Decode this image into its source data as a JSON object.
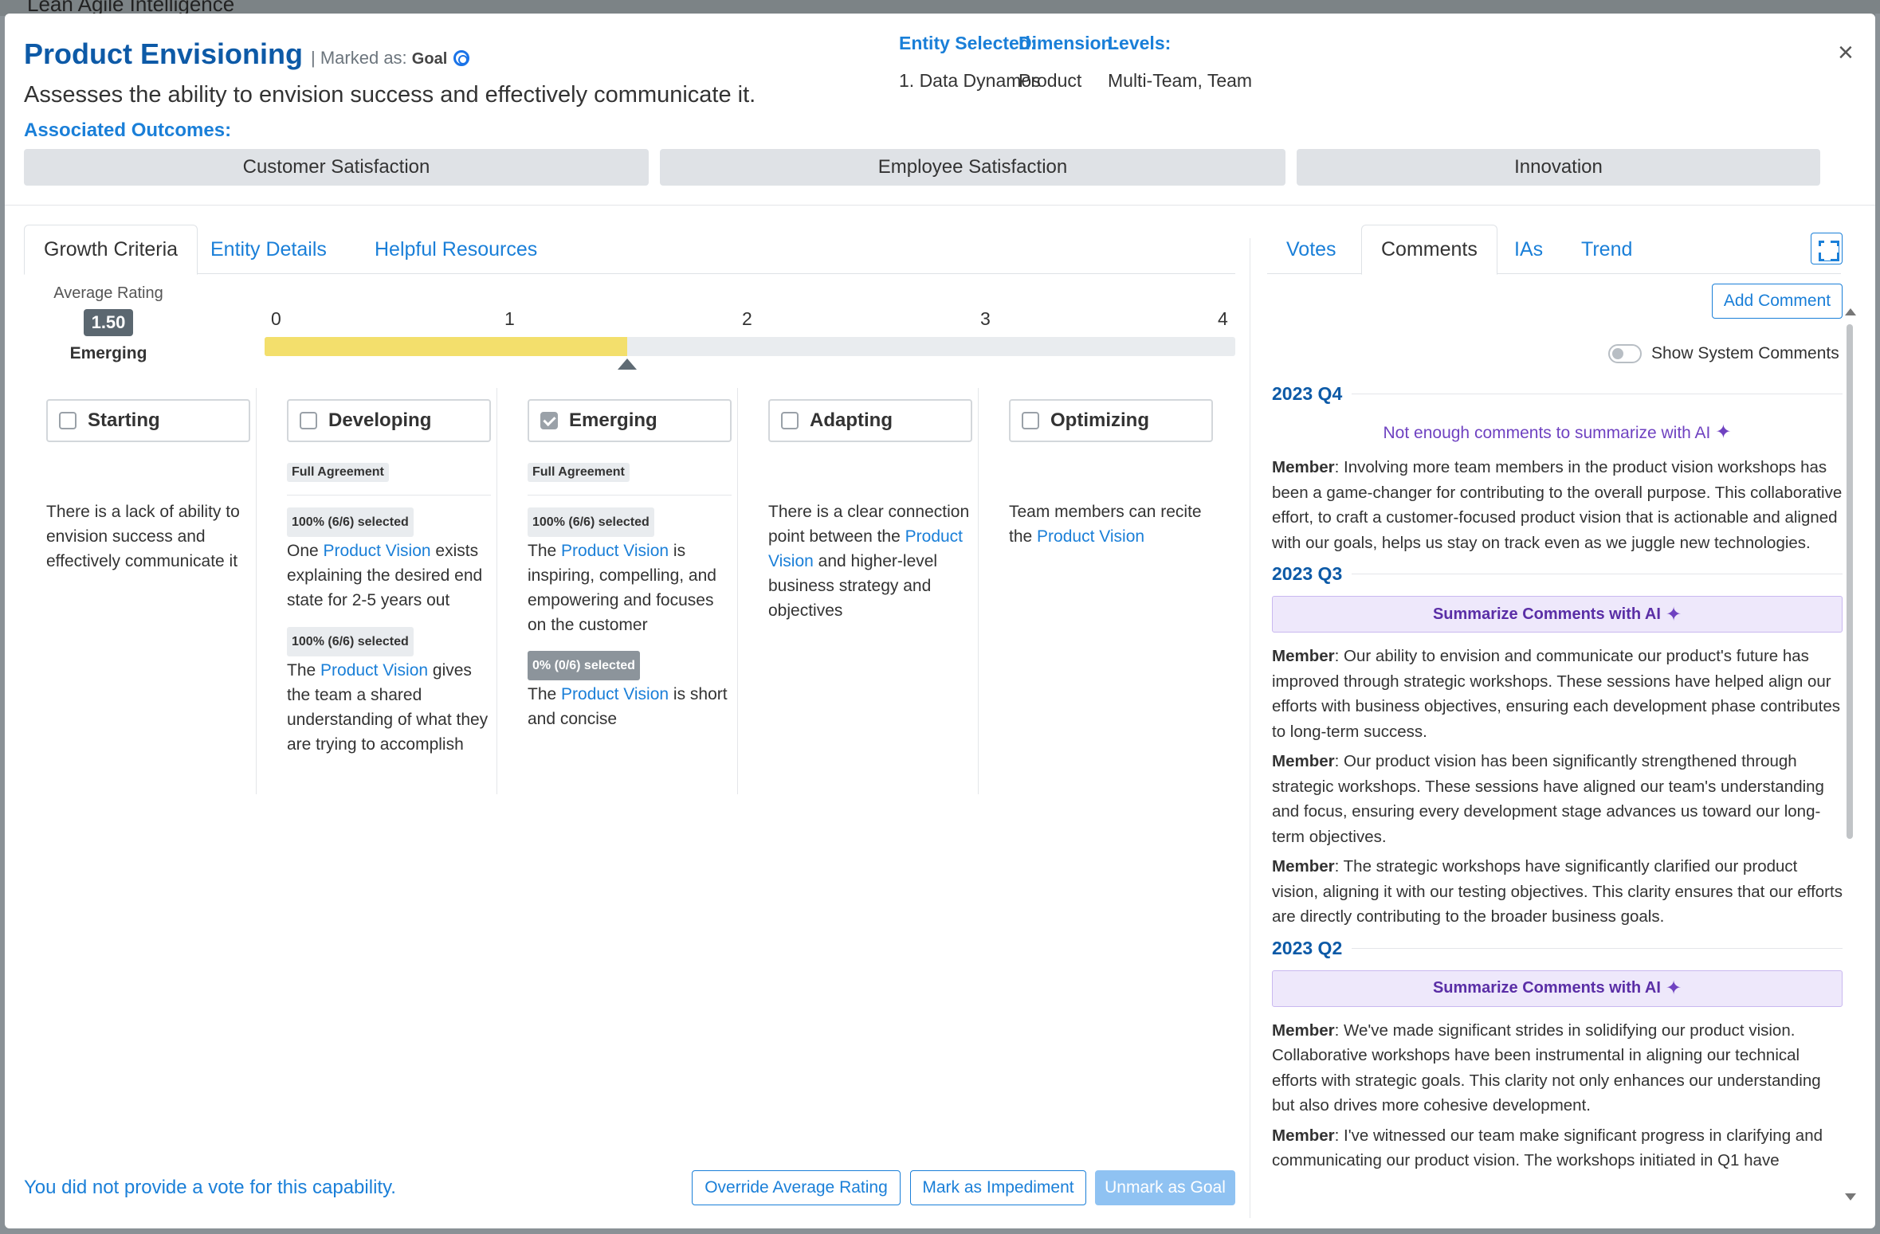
{
  "background": {
    "app_title": "Lean Agile Intelligence"
  },
  "header": {
    "title": "Product Envisioning",
    "marked_as_label": "| Marked as:",
    "marked_as_value": "Goal",
    "description": "Assesses the ability to envision success and effectively communicate it.",
    "associated_outcomes_label": "Associated Outcomes:",
    "close_label": "×"
  },
  "meta": {
    "entity_label": "Entity Selected:",
    "entity_value": "1. Data Dynamos",
    "dimension_label": "Dimension:",
    "dimension_value": "Product",
    "levels_label": "Levels:",
    "levels_value": "Multi-Team, Team"
  },
  "outcomes": [
    "Customer Satisfaction",
    "Employee Satisfaction",
    "Innovation"
  ],
  "left_tabs": [
    "Growth Criteria",
    "Entity Details",
    "Helpful Resources"
  ],
  "rating": {
    "label": "Average Rating",
    "value": "1.50",
    "numeric": 1.5,
    "max": 4,
    "level": "Emerging",
    "ticks": [
      "0",
      "1",
      "2",
      "3",
      "4"
    ]
  },
  "levels": [
    {
      "name": "Starting",
      "checked": false,
      "agreement": "",
      "criteria": [
        {
          "badge": "",
          "pre": "There is a lack of ability to envision success and effectively communicate it",
          "link": "",
          "post": ""
        }
      ]
    },
    {
      "name": "Developing",
      "checked": false,
      "agreement": "Full Agreement",
      "criteria": [
        {
          "badge": "100% (6/6) selected",
          "pre": "One ",
          "link": "Product Vision",
          "post": " exists explaining the desired end state for 2-5 years out"
        },
        {
          "badge": "100% (6/6) selected",
          "pre": "The ",
          "link": "Product Vision",
          "post": " gives the team a shared understanding of what they are trying to accomplish"
        }
      ]
    },
    {
      "name": "Emerging",
      "checked": true,
      "agreement": "Full Agreement",
      "criteria": [
        {
          "badge": "100% (6/6) selected",
          "pre": "The ",
          "link": "Product Vision",
          "post": " is inspiring, compelling, and empowering and focuses on the customer"
        },
        {
          "badge": "0% (0/6) selected",
          "pre": "The ",
          "link": "Product Vision",
          "post": " is short and concise"
        }
      ]
    },
    {
      "name": "Adapting",
      "checked": false,
      "agreement": "",
      "criteria": [
        {
          "badge": "",
          "pre": "There is a clear connection point between the ",
          "link": "Product Vision",
          "post": " and higher-level business strategy and objectives"
        }
      ]
    },
    {
      "name": "Optimizing",
      "checked": false,
      "agreement": "",
      "criteria": [
        {
          "badge": "",
          "pre": "Team members can recite the ",
          "link": "Product Vision",
          "post": ""
        }
      ]
    }
  ],
  "footer": {
    "no_vote": "You did not provide a vote for this capability.",
    "override": "Override Average Rating",
    "impediment": "Mark as Impediment",
    "unmark": "Unmark as Goal"
  },
  "right_tabs": [
    "Votes",
    "Comments",
    "IAs",
    "Trend"
  ],
  "comments_panel": {
    "add_comment": "Add Comment",
    "show_system": "Show System Comments",
    "author_label": "Member",
    "quarters": [
      {
        "label": "2023 Q4",
        "note": "Not enough comments to summarize with AI",
        "button": "",
        "comments": [
          "Involving more team members in the product vision workshops has been a game-changer for contributing to the overall purpose. This collaborative effort, to craft a customer-focused product vision that is actionable and aligned with our goals, helps us stay on track even as we juggle new technologies."
        ]
      },
      {
        "label": "2023 Q3",
        "note": "",
        "button": "Summarize Comments with AI",
        "comments": [
          "Our ability to envision and communicate our product's future has improved through strategic workshops. These sessions have helped align our efforts with business objectives, ensuring each development phase contributes to long-term success.",
          "Our product vision has been significantly strengthened through strategic workshops. These sessions have aligned our team's understanding and focus, ensuring every development stage advances us toward our long-term objectives.",
          "The strategic workshops have significantly clarified our product vision, aligning it with our testing objectives. This clarity ensures that our efforts are directly contributing to the broader business goals."
        ]
      },
      {
        "label": "2023 Q2",
        "note": "",
        "button": "Summarize Comments with AI",
        "comments": [
          "We've made significant strides in solidifying our product vision. Collaborative workshops have been instrumental in aligning our technical efforts with strategic goals. This clarity not only enhances our understanding but also drives more cohesive development.",
          "I've witnessed our team make significant progress in clarifying and communicating our product vision. The workshops initiated in Q1 have"
        ]
      }
    ]
  },
  "colors": {
    "accent": "#1a7fd8",
    "title": "#0d5aa7",
    "ai": "#6f42c1",
    "fill": "#f3df6c"
  }
}
